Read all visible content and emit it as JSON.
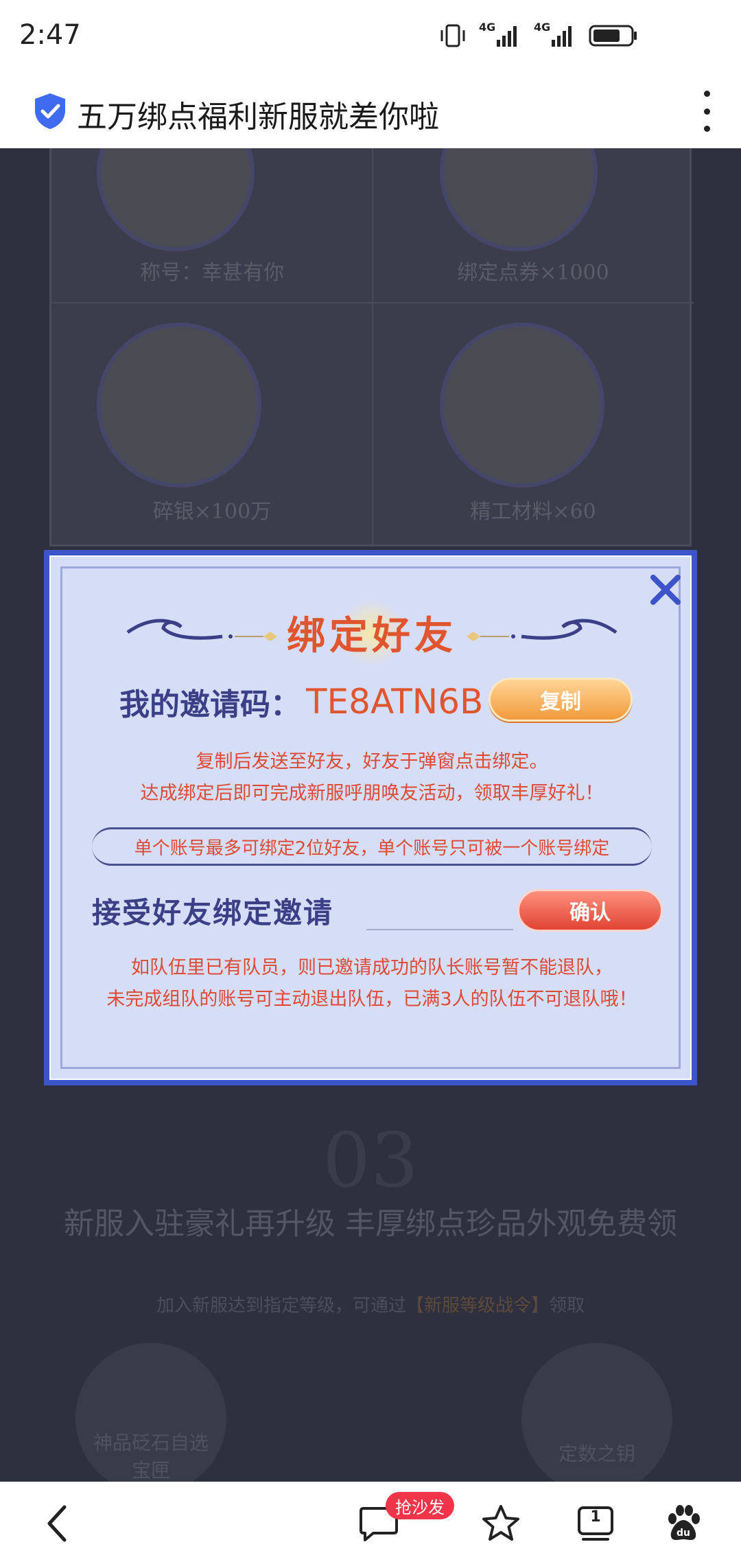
{
  "status_bar": {
    "time": "2:47",
    "network_1": "4G",
    "network_2": "4G",
    "icons": [
      "vibrate-icon",
      "signal-icon",
      "signal-icon",
      "battery-icon"
    ]
  },
  "browser": {
    "page_title": "五万绑点福利新服就差你啦",
    "icons": [
      "shield-check-icon",
      "more-vertical-icon"
    ]
  },
  "background_page": {
    "rewards": [
      {
        "label": "称号：幸甚有你"
      },
      {
        "label": "绑定点券×1000"
      },
      {
        "label": "碎银×100万"
      },
      {
        "label": "精工材料×60"
      }
    ],
    "section_number": "03",
    "headline": "新服入驻豪礼再升级 丰厚绑点珍品外观免费领",
    "sub_prefix": "加入新服达到指定等级，可通过",
    "sub_highlight": "【新服等级战令】",
    "sub_suffix": "领取",
    "cards": [
      {
        "label_1": "神品砭石自选",
        "label_2": "宝匣"
      },
      {
        "label_1": "定数之钥",
        "label_2": ""
      }
    ]
  },
  "modal": {
    "title": "绑定好友",
    "invite_label": "我的邀请码：",
    "invite_code": "TE8ATN6B",
    "copy_button": "复制",
    "note_1": "复制后发送至好友，好友于弹窗点击绑定。",
    "note_2": "达成绑定后即可完成新服呼朋唤友活动，领取丰厚好礼！",
    "limit_text": "单个账号最多可绑定2位好友，单个账号只可被一个账号绑定",
    "accept_label": "接受好友绑定邀请",
    "accept_input_value": "",
    "confirm_button": "确认",
    "warning_1": "如队伍里已有队员，则已邀请成功的队长账号暂不能退队，",
    "warning_2": "未完成组队的账号可主动退出队伍，已满3人的队伍不可退队哦！",
    "close_icon": "close-icon"
  },
  "bottom_nav": {
    "badge": "抢沙发",
    "tab_count": "1",
    "icons": [
      "back-icon",
      "comment-icon",
      "star-icon",
      "tabs-icon",
      "baidu-paw-icon"
    ]
  },
  "colors": {
    "modal_border": "#3d54c8",
    "modal_bg": "#d6ddf7",
    "accent_red": "#e0552e",
    "title_navy": "#3b3f86",
    "copy_orange": "#f29a3c",
    "confirm_red": "#e14432",
    "badge_red": "#f0354a"
  }
}
